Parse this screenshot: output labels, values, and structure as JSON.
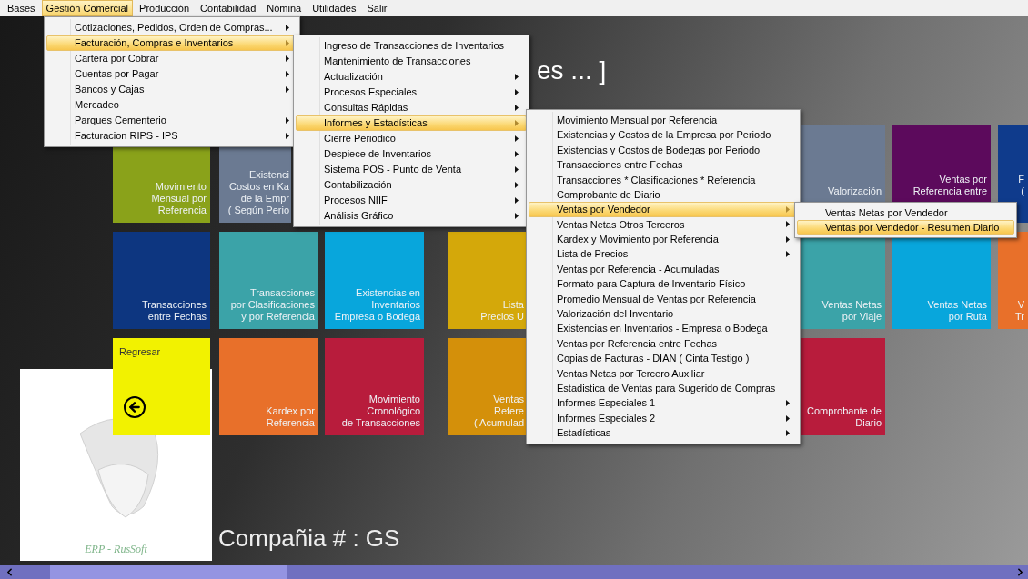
{
  "menu_bar": [
    {
      "label": "Bases",
      "selected": false
    },
    {
      "label": "Gestión Comercial",
      "selected": true
    },
    {
      "label": "Producción",
      "selected": false
    },
    {
      "label": "Contabilidad",
      "selected": false
    },
    {
      "label": "Nómina",
      "selected": false
    },
    {
      "label": "Utilidades",
      "selected": false
    },
    {
      "label": "Salir",
      "selected": false
    }
  ],
  "header_title": "es ... ]",
  "tile_rows": [
    [
      {
        "kind": "tile",
        "label": "Movimiento\nMensual por\nReferencia",
        "color": "#8aa21a"
      },
      {
        "kind": "tile",
        "label": "Existenci\nCostos en Ka\nde la Empr\n( Según Perio",
        "color": "#6b7a92"
      },
      {
        "kind": "tile",
        "label": "Valorización",
        "color": "#6b7a92"
      },
      {
        "kind": "tile",
        "label": "Ventas por\nReferencia entre",
        "color": "#5c0a5c"
      },
      {
        "kind": "tile",
        "label": "F\n(",
        "color": "#0f3b8c"
      }
    ],
    [
      {
        "kind": "tile",
        "label": "Transacciones\nentre Fechas",
        "color": "#0d3680"
      },
      {
        "kind": "tile",
        "label": "Transacciones\npor Clasificaciones\ny por Referencia",
        "color": "#3ba3a8"
      },
      {
        "kind": "tile",
        "label": "Existencias en\nInventarios\nEmpresa o Bodega",
        "color": "#08a6dc"
      },
      {
        "kind": "tile",
        "label": "Lista\nPrecios U",
        "color": "#d4a80a"
      },
      {
        "kind": "tile",
        "label": "Ventas Netas\npor Viaje",
        "color": "#3ba3a8"
      },
      {
        "kind": "tile",
        "label": "Ventas Netas\npor Ruta",
        "color": "#08a6dc"
      },
      {
        "kind": "tile",
        "label": "V\nTr",
        "color": "#e8702a"
      }
    ],
    [
      {
        "kind": "back",
        "label": "Regresar",
        "color": "#f2f200"
      },
      {
        "kind": "tile",
        "label": "Kardex por\nReferencia",
        "color": "#e8702a"
      },
      {
        "kind": "tile",
        "label": "Movimiento\nCronológico\nde Transacciones",
        "color": "#b81c3c"
      },
      {
        "kind": "tile",
        "label": "Ventas\nRefere\n( Acumulad",
        "color": "#d4900a"
      },
      {
        "kind": "tile",
        "label": "Comprobante de\nDiario",
        "color": "#b81c3c"
      }
    ]
  ],
  "logo_caption": "ERP - RusSoft",
  "company": "Compañia # : GS",
  "menus": [
    [
      {
        "label": "Cotizaciones, Pedidos, Orden de  Compras...",
        "submenu": true,
        "selected": false
      },
      {
        "label": "Facturación, Compras e Inventarios",
        "submenu": true,
        "selected": true
      },
      {
        "label": "Cartera por Cobrar",
        "submenu": true,
        "selected": false
      },
      {
        "label": "Cuentas por Pagar",
        "submenu": true,
        "selected": false
      },
      {
        "label": "Bancos y Cajas",
        "submenu": true,
        "selected": false
      },
      {
        "label": "Mercadeo",
        "submenu": false,
        "selected": false
      },
      {
        "label": "Parques Cementerio",
        "submenu": true,
        "selected": false
      },
      {
        "label": "Facturacion RIPS - IPS",
        "submenu": true,
        "selected": false
      }
    ],
    [
      {
        "label": "Ingreso de Transacciones de Inventarios",
        "submenu": false,
        "selected": false
      },
      {
        "label": "Mantenimiento de Transacciones",
        "submenu": false,
        "selected": false
      },
      {
        "label": "Actualización",
        "submenu": true,
        "selected": false
      },
      {
        "label": "Procesos Especiales",
        "submenu": true,
        "selected": false
      },
      {
        "label": "Consultas Rápidas",
        "submenu": true,
        "selected": false
      },
      {
        "label": "Informes y Estadísticas",
        "submenu": true,
        "selected": true
      },
      {
        "label": "Cierre Periodico",
        "submenu": true,
        "selected": false
      },
      {
        "label": "Despiece de Inventarios",
        "submenu": true,
        "selected": false
      },
      {
        "label": "Sistema POS - Punto de Venta",
        "submenu": true,
        "selected": false
      },
      {
        "label": "Contabilización",
        "submenu": true,
        "selected": false
      },
      {
        "label": "Procesos NIIF",
        "submenu": true,
        "selected": false
      },
      {
        "label": "Análisis Gráfico",
        "submenu": true,
        "selected": false
      }
    ],
    [
      {
        "label": "Movimiento Mensual por Referencia",
        "submenu": false,
        "selected": false
      },
      {
        "label": "Existencias y Costos de la Empresa por Periodo",
        "submenu": false,
        "selected": false
      },
      {
        "label": "Existencias y Costos de Bodegas por Periodo",
        "submenu": false,
        "selected": false
      },
      {
        "label": "Transacciones entre Fechas",
        "submenu": false,
        "selected": false
      },
      {
        "label": "Transacciones * Clasificaciones * Referencia",
        "submenu": false,
        "selected": false
      },
      {
        "label": "Comprobante de Diario",
        "submenu": false,
        "selected": false
      },
      {
        "label": "Ventas por Vendedor",
        "submenu": true,
        "selected": true
      },
      {
        "label": "Ventas Netas Otros Terceros",
        "submenu": true,
        "selected": false
      },
      {
        "label": "Kardex y Movimiento por Referencia",
        "submenu": true,
        "selected": false
      },
      {
        "label": "Lista de Precios",
        "submenu": true,
        "selected": false
      },
      {
        "label": "Ventas por Referencia - Acumuladas",
        "submenu": false,
        "selected": false
      },
      {
        "label": "Formato para Captura de Inventario Físico",
        "submenu": false,
        "selected": false
      },
      {
        "label": "Promedio Mensual de Ventas por Referencia",
        "submenu": false,
        "selected": false
      },
      {
        "label": "Valorización del Inventario",
        "submenu": false,
        "selected": false
      },
      {
        "label": "Existencias en Inventarios - Empresa o Bodega",
        "submenu": false,
        "selected": false
      },
      {
        "label": "Ventas por Referencia entre Fechas",
        "submenu": false,
        "selected": false
      },
      {
        "label": "Copias de Facturas - DIAN ( Cinta Testigo )",
        "submenu": false,
        "selected": false
      },
      {
        "label": "Ventas Netas por Tercero Auxiliar",
        "submenu": false,
        "selected": false
      },
      {
        "label": "Estadistica de Ventas para Sugerido de Compras",
        "submenu": false,
        "selected": false
      },
      {
        "label": "Informes Especiales 1",
        "submenu": true,
        "selected": false
      },
      {
        "label": "Informes Especiales 2",
        "submenu": true,
        "selected": false
      },
      {
        "label": "Estadísticas",
        "submenu": true,
        "selected": false
      }
    ],
    [
      {
        "label": "Ventas Netas por Vendedor",
        "selected": false
      },
      {
        "label": "Ventas por Vendedor - Resumen Diario",
        "selected": true
      }
    ]
  ]
}
